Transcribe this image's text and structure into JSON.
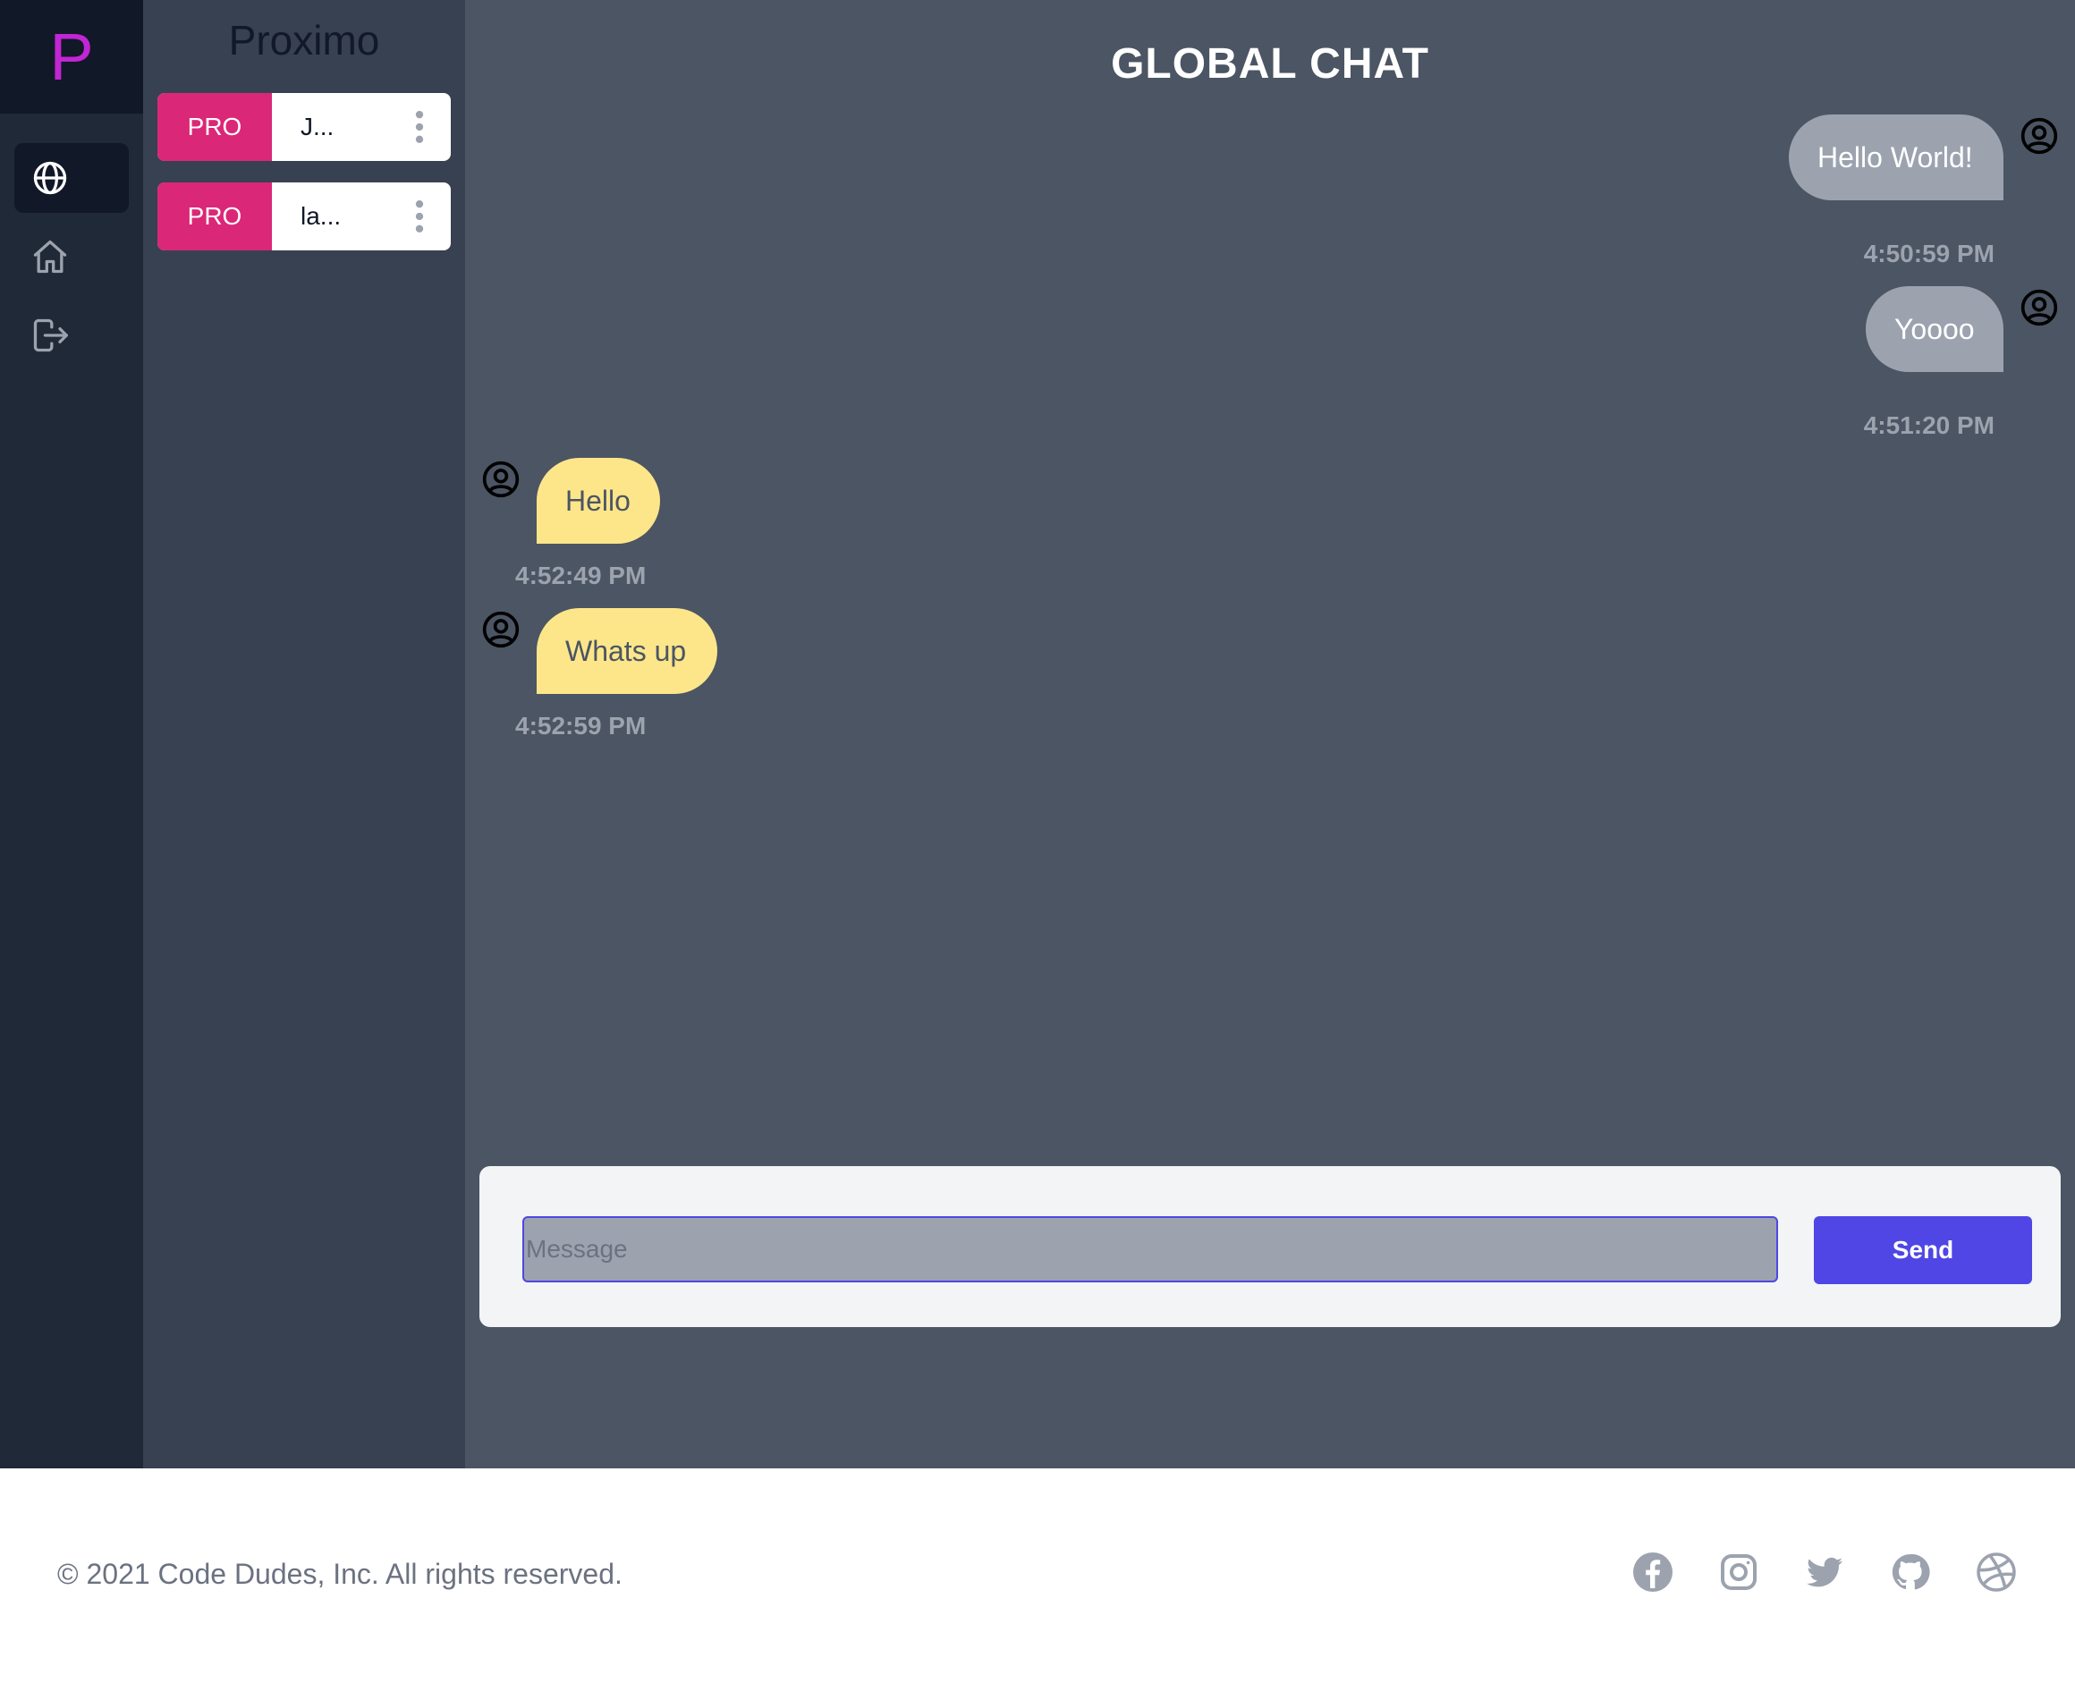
{
  "logo": {
    "letter": "P"
  },
  "nav": {
    "items": [
      {
        "icon": "globe-icon",
        "active": true
      },
      {
        "icon": "home-icon",
        "active": false
      },
      {
        "icon": "logout-icon",
        "active": false
      }
    ]
  },
  "users_panel": {
    "brand": "Proximo",
    "users": [
      {
        "badge": "PRO",
        "name": "J..."
      },
      {
        "badge": "PRO",
        "name": "la..."
      }
    ]
  },
  "chat": {
    "title": "GLOBAL CHAT",
    "messages": [
      {
        "text": "Hello World!",
        "time": "4:50:59 PM",
        "direction": "outgoing"
      },
      {
        "text": "Yoooo",
        "time": "4:51:20 PM",
        "direction": "outgoing"
      },
      {
        "text": "Hello",
        "time": "4:52:49 PM",
        "direction": "incoming"
      },
      {
        "text": "Whats up",
        "time": "4:52:59 PM",
        "direction": "incoming"
      }
    ],
    "composer": {
      "placeholder": "Message",
      "value": "",
      "send_label": "Send"
    }
  },
  "footer": {
    "copyright": "© 2021 Code Dudes, Inc. All rights reserved.",
    "social": [
      "facebook-icon",
      "instagram-icon",
      "twitter-icon",
      "github-icon",
      "dribbble-icon"
    ]
  },
  "colors": {
    "rail": "#1f2937",
    "panel": "#374151",
    "chat_bg": "#4b5563",
    "pro_badge": "#db2777",
    "outgoing_bubble": "#9ca3af",
    "incoming_bubble": "#fde68a",
    "send_button": "#4f46e5",
    "logo": "#c026d3"
  }
}
